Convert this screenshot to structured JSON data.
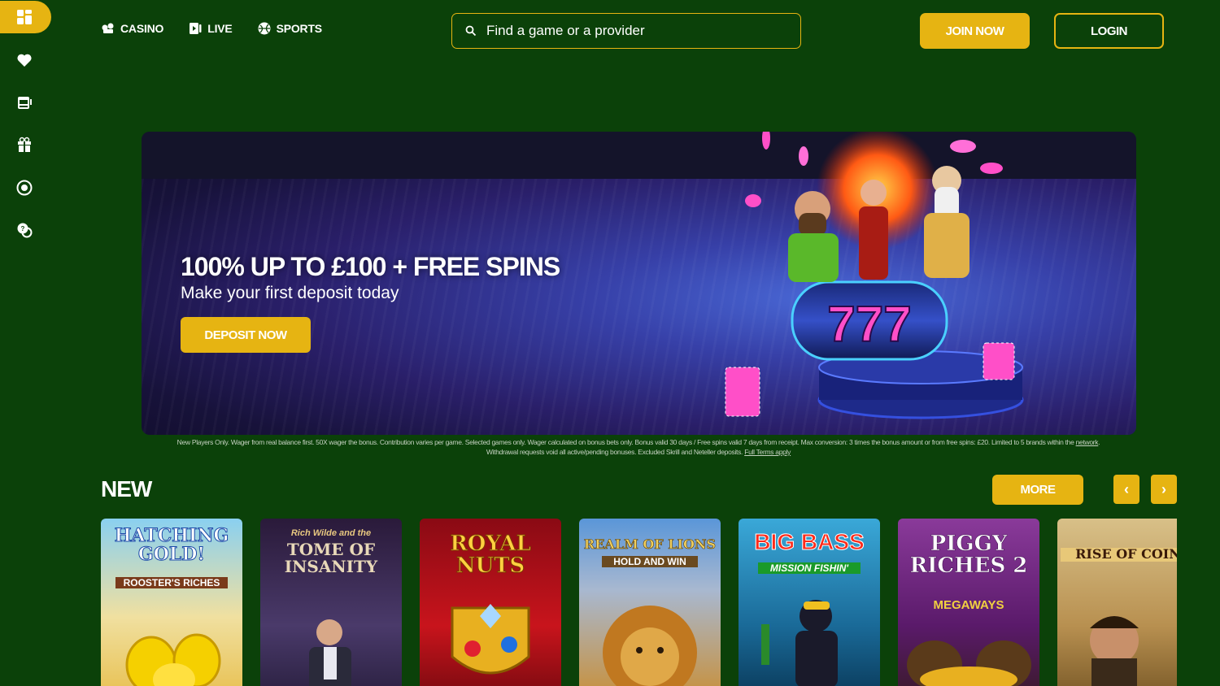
{
  "sidebar": {
    "items": [
      {
        "icon": "grid-icon",
        "active": true
      },
      {
        "icon": "heart-icon",
        "active": false
      },
      {
        "icon": "slot-machine-icon",
        "active": false
      },
      {
        "icon": "gift-icon",
        "active": false
      },
      {
        "icon": "chip-icon",
        "active": false
      },
      {
        "icon": "chat-icon",
        "active": false
      }
    ]
  },
  "header": {
    "nav": [
      {
        "label": "CASINO",
        "icon": "cards-icon"
      },
      {
        "label": "LIVE",
        "icon": "live-dealer-icon"
      },
      {
        "label": "SPORTS",
        "icon": "ball-icon"
      }
    ],
    "search_placeholder": "Find a game or a provider",
    "join_label": "JOIN NOW",
    "login_label": "LOGIN"
  },
  "banner": {
    "title": "100% UP TO £100 + FREE SPINS",
    "subtitle": "Make your first deposit today",
    "cta_label": "DEPOSIT NOW",
    "reels": "777"
  },
  "terms": {
    "text_1": "New Players Only. Wager from real balance first. 50X wager the bonus. Contribution varies per game. Selected games only. Wager calculated on bonus bets only. Bonus valid 30 days / Free spins valid 7 days from receipt. Max conversion: 3 times the bonus amount or from free spins: £20. Limited to 5 brands within the",
    "network_link": "network",
    "text_2": ". Withdrawal requests void all active/pending bonuses. Excluded Skrill and Neteller deposits.",
    "full_terms_link": "Full Terms apply"
  },
  "new_section": {
    "title": "NEW",
    "more_label": "MORE",
    "prev_label": "‹",
    "next_label": "›",
    "games": [
      {
        "title": "HATCHING GOLD!",
        "subtitle": "ROOSTER'S RICHES",
        "bg": "#f0d06a"
      },
      {
        "title": "TOME OF INSANITY",
        "subtitle": "Rich Wilde and the",
        "bg": "#3b2a55"
      },
      {
        "title": "ROYAL NUTS",
        "subtitle": "",
        "bg": "#b8141c"
      },
      {
        "title": "REALM OF LIONS",
        "subtitle": "HOLD AND WIN",
        "bg": "#5a86b8"
      },
      {
        "title": "BIG BASS",
        "subtitle": "MISSION FISHIN'",
        "bg": "#2a8fb8"
      },
      {
        "title": "PIGGY RICHES 2",
        "subtitle": "MEGAWAYS",
        "bg": "#6b2a7a"
      },
      {
        "title": "RISE OF COIN",
        "subtitle": "",
        "bg": "#c9a860"
      }
    ]
  }
}
